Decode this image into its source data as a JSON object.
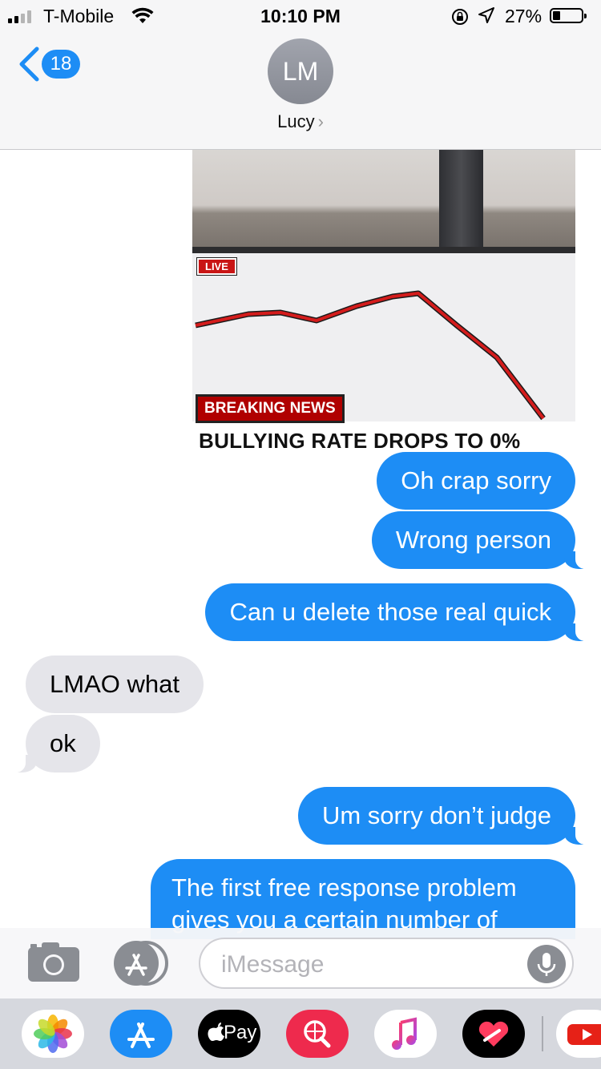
{
  "status_bar": {
    "carrier": "T-Mobile",
    "time": "10:10 PM",
    "battery_percent": "27%",
    "battery_level": 0.27,
    "signal_bars": 2
  },
  "nav": {
    "back_count": "18",
    "avatar_initials": "LM",
    "contact_name": "Lucy",
    "chevron": "›"
  },
  "meme": {
    "live_label": "LIVE",
    "breaking_label": "BREAKING NEWS",
    "headline": "BULLYING RATE DROPS TO 0%"
  },
  "messages": [
    {
      "direction": "outgoing",
      "text": "Oh crap sorry"
    },
    {
      "direction": "outgoing",
      "text": "Wrong person"
    },
    {
      "direction": "outgoing",
      "text": "Can u delete those real quick"
    },
    {
      "direction": "incoming",
      "text": "LMAO what"
    },
    {
      "direction": "incoming",
      "text": "ok"
    },
    {
      "direction": "outgoing",
      "text": "Um sorry don’t judge"
    },
    {
      "direction": "outgoing",
      "text": "The first free response problem gives you a certain number of"
    }
  ],
  "input": {
    "placeholder": "iMessage"
  },
  "app_drawer": {
    "apps": [
      "photos-icon",
      "app-store-icon",
      "apple-pay-icon",
      "web-images-icon",
      "music-icon",
      "digital-touch-icon",
      "youtube-icon"
    ],
    "apple_pay_label": "Pay"
  },
  "colors": {
    "imessage_blue": "#1d8df5",
    "incoming_gray": "#e5e5ea"
  }
}
